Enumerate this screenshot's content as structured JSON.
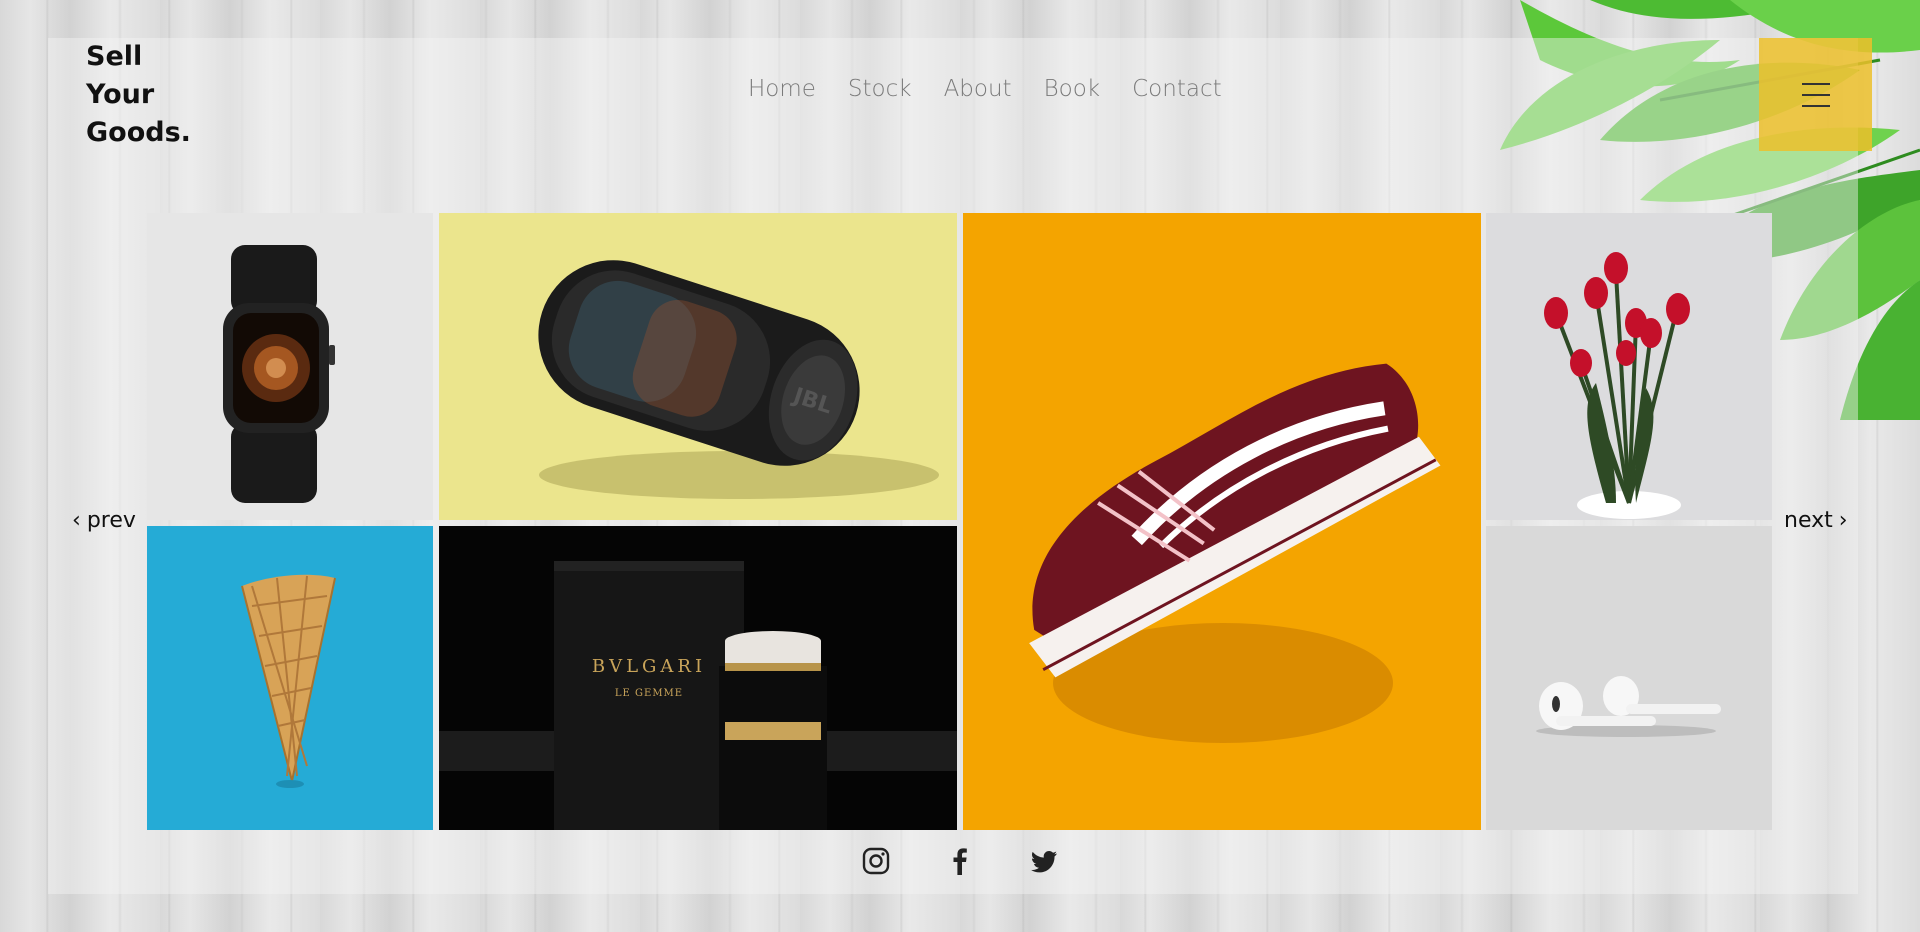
{
  "brand": {
    "line1": "Sell",
    "line2": "Your",
    "line3": "Goods."
  },
  "nav": {
    "items": [
      {
        "label": "Home"
      },
      {
        "label": "Stock"
      },
      {
        "label": "About"
      },
      {
        "label": "Book"
      },
      {
        "label": "Contact"
      }
    ]
  },
  "menu": {
    "icon": "hamburger-icon",
    "color": "#ecc02a"
  },
  "carousel": {
    "prev_label": "prev",
    "next_label": "next",
    "prev_icon": "chevron-left-icon",
    "next_icon": "chevron-right-icon"
  },
  "gallery": {
    "items": [
      {
        "name": "watch",
        "background": "#e6e6e6",
        "text": ""
      },
      {
        "name": "speaker",
        "background": "#ebe58d",
        "text": "JBL"
      },
      {
        "name": "sneaker",
        "background": "#f4a400",
        "text": ""
      },
      {
        "name": "tulips",
        "background": "#dcdcde",
        "text": ""
      },
      {
        "name": "ice-cream-cone",
        "background": "#25abd6",
        "text": ""
      },
      {
        "name": "perfume",
        "background": "#050505",
        "text": "BVLGARI",
        "subtext": "LE GEMME"
      },
      {
        "name": "earbuds",
        "background": "#d9d9d9",
        "text": ""
      }
    ]
  },
  "social": [
    {
      "icon": "instagram-icon"
    },
    {
      "icon": "facebook-icon"
    },
    {
      "icon": "twitter-icon"
    }
  ]
}
